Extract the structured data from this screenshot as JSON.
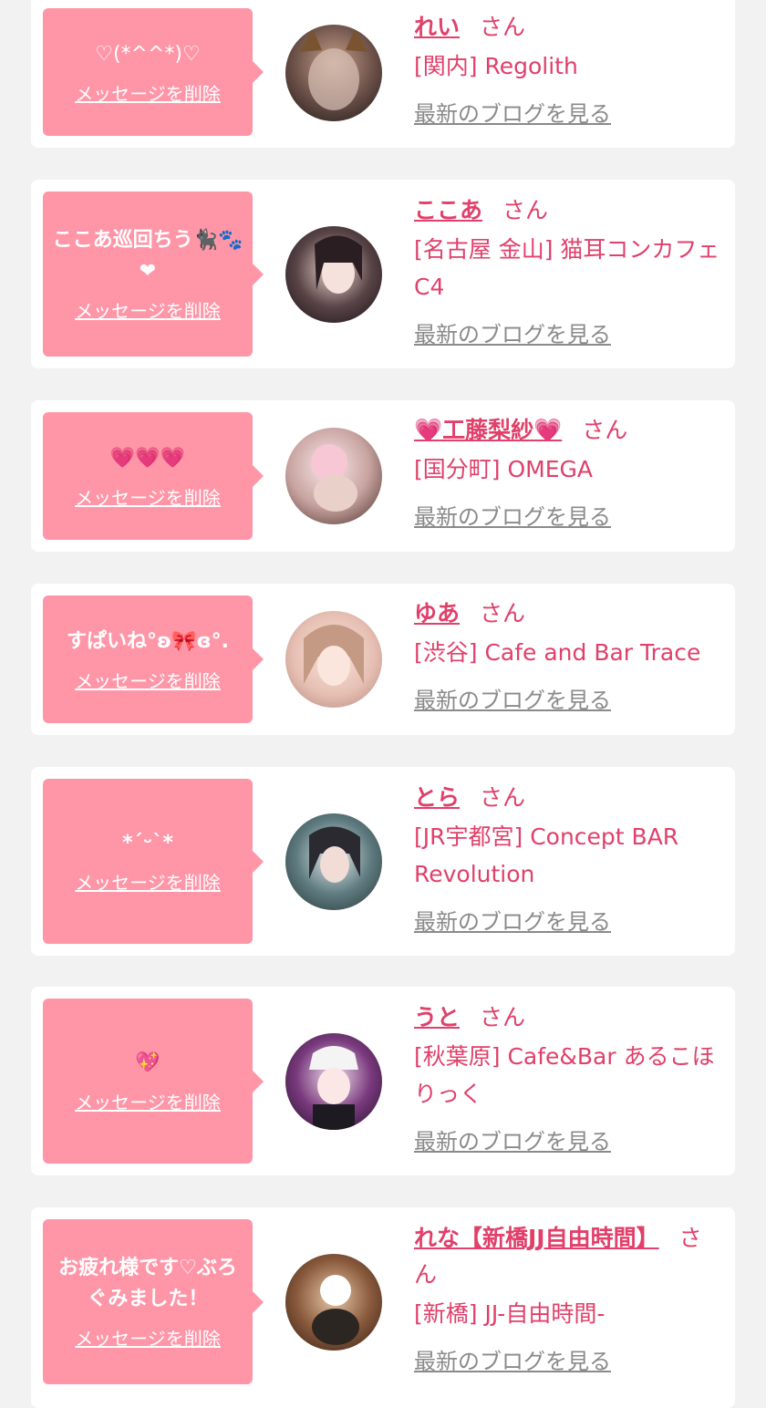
{
  "entries": [
    {
      "message": "♡(*^^*)♡",
      "delete_label": "メッセージを削除",
      "name": "れい",
      "honorific": "さん",
      "shop": "[関内] Regolith",
      "blog_label": "最新のブログを見る",
      "avatar_icon": "profile-photo"
    },
    {
      "message": "ここあ巡回ちう🐈‍⬛🐾❤",
      "delete_label": "メッセージを削除",
      "name": "ここあ",
      "honorific": "さん",
      "shop": "[名古屋 金山] 猫耳コンカフェ C4",
      "blog_label": "最新のブログを見る",
      "avatar_icon": "profile-photo"
    },
    {
      "message": "💗💗💗",
      "delete_label": "メッセージを削除",
      "name": "💗工藤梨紗💗",
      "honorific": "さん",
      "shop": "[国分町] OMEGA",
      "blog_label": "最新のブログを見る",
      "avatar_icon": "profile-photo"
    },
    {
      "message": "すぱいね°ʚ🎀ɞ°.",
      "delete_label": "メッセージを削除",
      "name": "ゆあ",
      "honorific": "さん",
      "shop": "[渋谷] Cafe and Bar Trace",
      "blog_label": "最新のブログを見る",
      "avatar_icon": "profile-photo"
    },
    {
      "message": "*ˊᵕˋ*",
      "delete_label": "メッセージを削除",
      "name": "とら",
      "honorific": "さん",
      "shop": "[JR宇都宮] Concept BAR Revolution",
      "blog_label": "最新のブログを見る",
      "avatar_icon": "profile-photo"
    },
    {
      "message": "💖",
      "delete_label": "メッセージを削除",
      "name": "うと",
      "honorific": "さん",
      "shop": "[秋葉原] Cafe&Bar あるこほりっく",
      "blog_label": "最新のブログを見る",
      "avatar_icon": "profile-photo"
    },
    {
      "message": "お疲れ様です♡ぶろぐみました！",
      "delete_label": "メッセージを削除",
      "name": "れな【新橋JJ自由時間】",
      "honorific": "さん",
      "shop": "[新橋] JJ-自由時間-",
      "blog_label": "最新のブログを見る",
      "avatar_icon": "profile-photo"
    }
  ],
  "colors": {
    "bubble": "#ff96a8",
    "accent_text": "#e0406a",
    "link_gray": "#8a8a8a",
    "background": "#f2f2f2"
  }
}
